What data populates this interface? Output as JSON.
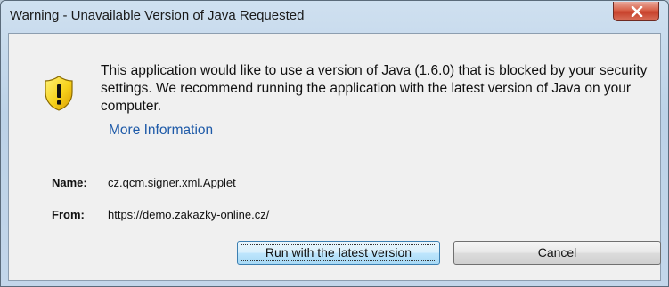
{
  "window": {
    "title": "Warning - Unavailable Version of Java Requested"
  },
  "icons": {
    "close": "close-icon",
    "warning": "warning-shield-icon"
  },
  "message": {
    "body": "This application would like to use a version of Java (1.6.0) that is blocked by your security settings. We recommend running the application with the latest version of Java on your computer.",
    "more_info_link": "More Information"
  },
  "fields": {
    "name_label": "Name:",
    "name_value": "cz.qcm.signer.xml.Applet",
    "from_label": "From:",
    "from_value": "https://demo.zakazky-online.cz/"
  },
  "buttons": {
    "run_label": "Run with the latest version",
    "cancel_label": "Cancel"
  },
  "colors": {
    "link": "#1e5aa8",
    "close_button": "#c7402a",
    "shield_yellow": "#f7d21b"
  }
}
